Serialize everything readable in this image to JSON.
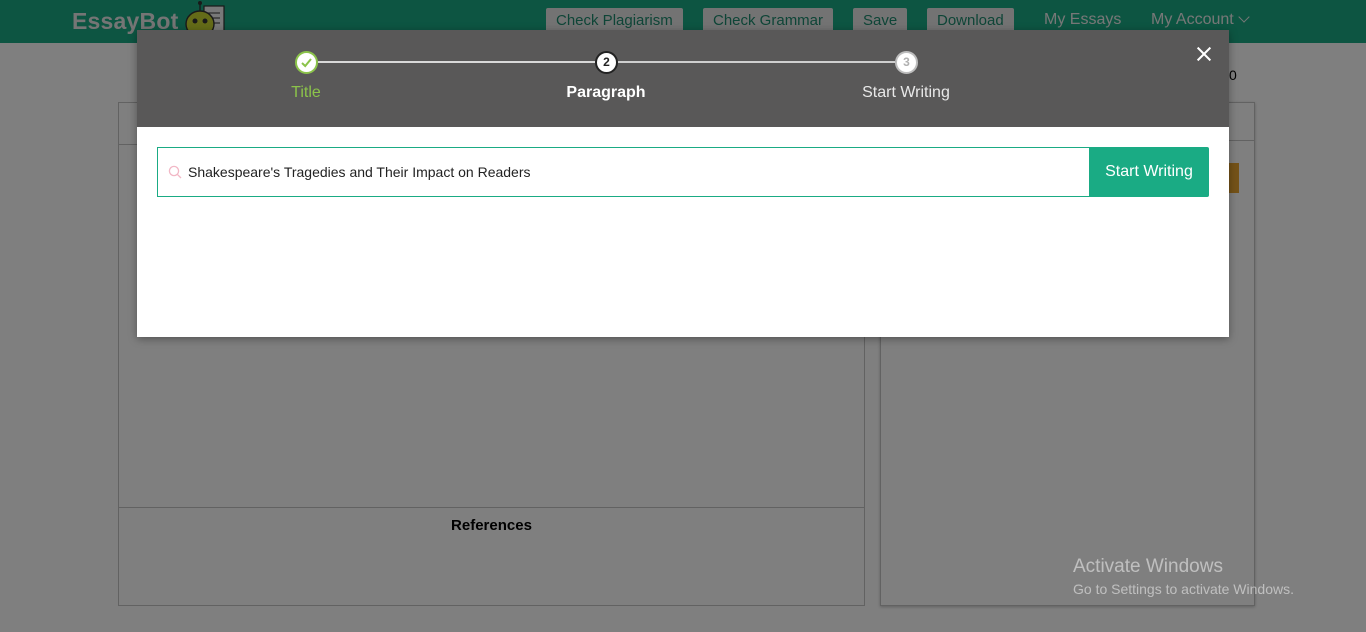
{
  "app": {
    "logo_text": "EssayBot"
  },
  "nav": {
    "check_plagiarism": "Check Plagiarism",
    "check_grammar": "Check Grammar",
    "save": "Save",
    "download": "Download",
    "my_essays": "My Essays",
    "my_account": "My Account"
  },
  "editor": {
    "references_label": "References",
    "count_value": "0"
  },
  "modal": {
    "steps": [
      {
        "number": "1",
        "label": "Title",
        "state": "complete"
      },
      {
        "number": "2",
        "label": "Paragraph",
        "state": "active"
      },
      {
        "number": "3",
        "label": "Start Writing",
        "state": "pending"
      }
    ],
    "search": {
      "value": "Shakespeare's Tragedies and Their Impact on Readers"
    },
    "start_button_label": "Start Writing"
  },
  "watermark": {
    "line1": "Activate Windows",
    "line2": "Go to Settings to activate Windows."
  },
  "colors": {
    "brand_green": "#1aab84",
    "step_complete": "#8bc34a",
    "modal_header": "#595858",
    "accent_orange": "#e8a531"
  }
}
